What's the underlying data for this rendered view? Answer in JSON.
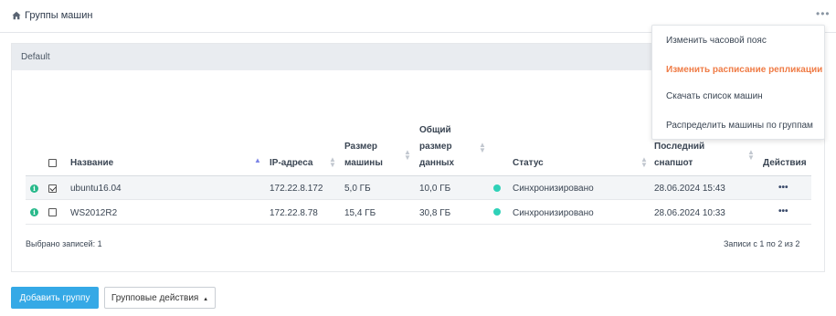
{
  "header": {
    "title": "Группы машин",
    "more_label": "•••"
  },
  "group": {
    "name": "Default"
  },
  "table": {
    "columns": {
      "name": "Название",
      "ip": "IP-адреса",
      "size_line1": "Размер",
      "size_line2": "машины",
      "total_line1": "Общий",
      "total_line2": "размер",
      "total_line3": "данных",
      "status": "Статус",
      "snapshot_line1": "Последний",
      "snapshot_line2": "снапшот",
      "actions": "Действия"
    },
    "rows": [
      {
        "selected": true,
        "name": "ubuntu16.04",
        "ip": "172.22.8.172",
        "size": "5,0 ГБ",
        "total": "10,0 ГБ",
        "status": "Синхронизировано",
        "snapshot": "28.06.2024 15:43",
        "actions": "•••"
      },
      {
        "selected": false,
        "name": "WS2012R2",
        "ip": "172.22.8.78",
        "size": "15,4 ГБ",
        "total": "30,8 ГБ",
        "status": "Синхронизировано",
        "snapshot": "28.06.2024 10:33",
        "actions": "•••"
      }
    ],
    "selected_count": "Выбрано записей: 1",
    "pagination": "Записи с 1 по 2 из 2"
  },
  "buttons": {
    "add_group": "Добавить группу",
    "group_actions": "Групповые действия"
  },
  "menu": {
    "items": [
      "Изменить часовой пояс",
      "Изменить расписание репликации",
      "Скачать список машин",
      "Распределить машины по группам"
    ],
    "active_color": "#ef7b45"
  },
  "colors": {
    "primary_button": "#35a9e6",
    "status_synced": "#2fd1b8",
    "info_icon": "#27b98a"
  }
}
